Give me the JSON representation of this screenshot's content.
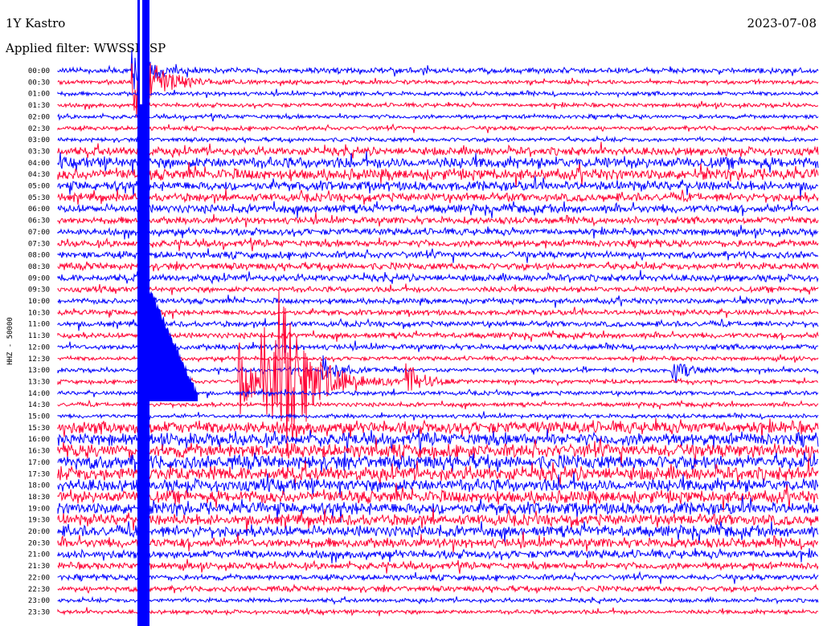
{
  "header": {
    "station": "1Y Kastro",
    "date": "2023-07-08",
    "filter": "Applied filter: WWSSN-SP"
  },
  "chart_data": {
    "type": "line",
    "title": "1Y Kastro",
    "ylabel": "HHZ - 50000",
    "row_labels": [
      "00:00",
      "00:30",
      "01:00",
      "01:30",
      "02:00",
      "02:30",
      "03:00",
      "03:30",
      "04:00",
      "04:30",
      "05:00",
      "05:30",
      "06:00",
      "06:30",
      "07:00",
      "07:30",
      "08:00",
      "08:30",
      "09:00",
      "09:30",
      "10:00",
      "10:30",
      "11:00",
      "11:30",
      "12:00",
      "12:30",
      "13:00",
      "13:30",
      "14:00",
      "14:30",
      "15:00",
      "15:30",
      "16:00",
      "16:30",
      "17:00",
      "17:30",
      "18:00",
      "18:30",
      "19:00",
      "19:30",
      "20:00",
      "20:30",
      "21:00",
      "21:30",
      "22:00",
      "22:30",
      "23:00",
      "23:30"
    ],
    "colors": [
      "#0000ff",
      "#ff0033"
    ],
    "noise_level": [
      4,
      3,
      3,
      3,
      3,
      3,
      3,
      6,
      8,
      8,
      7,
      6,
      6,
      5,
      5,
      5,
      5,
      5,
      5,
      4,
      4,
      4,
      4,
      4,
      4,
      3,
      3,
      3,
      3,
      3,
      3,
      9,
      9,
      10,
      10,
      10,
      9,
      9,
      9,
      8,
      8,
      7,
      6,
      5,
      4,
      4,
      3,
      3
    ],
    "events": [
      {
        "row": 0,
        "x": 0.1,
        "amplitude": 40,
        "decay": 0.02,
        "label": ""
      },
      {
        "row": 1,
        "x": 0.1,
        "amplitude": 60,
        "decay": 0.03,
        "label": ""
      },
      {
        "row": 27,
        "x": 0.24,
        "amplitude": 55,
        "decay": 0.02,
        "label": ""
      },
      {
        "row": 27,
        "x": 0.27,
        "amplitude": 90,
        "decay": 0.03,
        "label": ""
      },
      {
        "row": 27,
        "x": 0.29,
        "amplitude": 110,
        "decay": 0.04,
        "label": ""
      },
      {
        "row": 26,
        "x": 0.35,
        "amplitude": 20,
        "decay": 0.02,
        "label": ""
      },
      {
        "row": 27,
        "x": 0.46,
        "amplitude": 25,
        "decay": 0.02,
        "label": ""
      },
      {
        "row": 26,
        "x": 0.81,
        "amplitude": 18,
        "decay": 0.02,
        "label": ""
      }
    ]
  }
}
